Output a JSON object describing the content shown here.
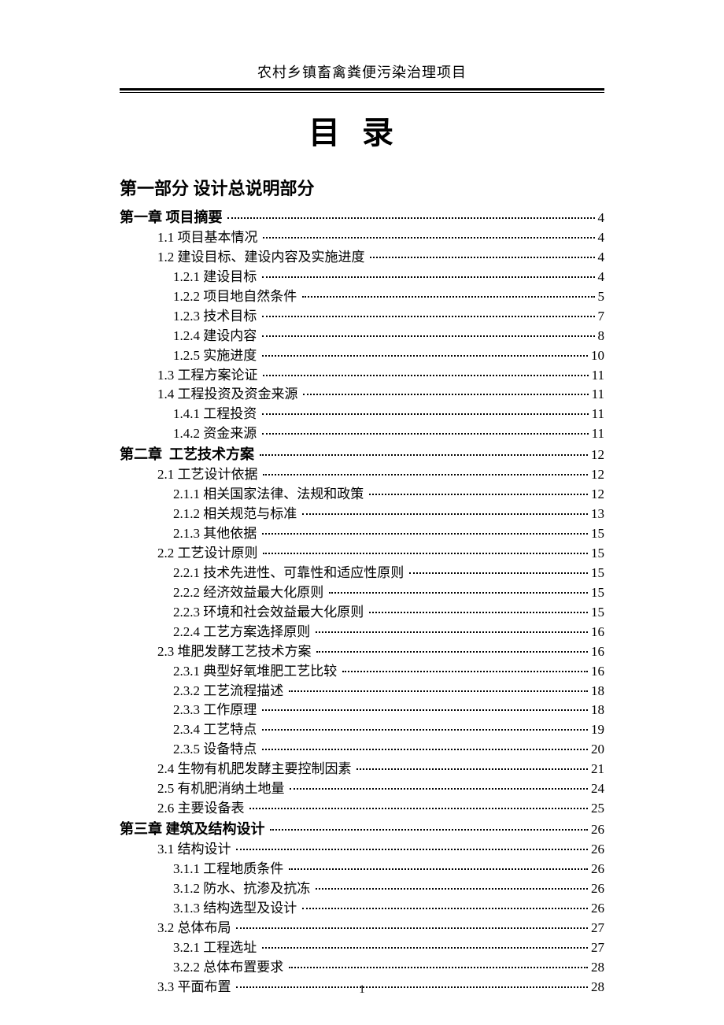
{
  "running_head": "农村乡镇畜禽粪便污染治理项目",
  "doc_title": "目录",
  "part_title": "第一部分 设计总说明部分",
  "toc_entries": [
    {
      "level": 0,
      "label": "第一章 项目摘要",
      "page": "4"
    },
    {
      "level": 1,
      "label": "1.1 项目基本情况",
      "page": "4"
    },
    {
      "level": 1,
      "label": "1.2 建设目标、建设内容及实施进度",
      "page": "4"
    },
    {
      "level": 2,
      "label": "1.2.1 建设目标",
      "page": "4"
    },
    {
      "level": 2,
      "label": "1.2.2 项目地自然条件",
      "page": "5"
    },
    {
      "level": 2,
      "label": "1.2.3 技术目标",
      "page": "7"
    },
    {
      "level": 2,
      "label": "1.2.4 建设内容",
      "page": "8"
    },
    {
      "level": 2,
      "label": "1.2.5 实施进度",
      "page": "10"
    },
    {
      "level": 1,
      "label": "1.3 工程方案论证",
      "page": "11"
    },
    {
      "level": 1,
      "label": "1.4 工程投资及资金来源",
      "page": "11"
    },
    {
      "level": 2,
      "label": "1.4.1 工程投资",
      "page": "11"
    },
    {
      "level": 2,
      "label": "1.4.2 资金来源",
      "page": "11"
    },
    {
      "level": 0,
      "label": "第二章  工艺技术方案",
      "page": "12"
    },
    {
      "level": 1,
      "label": "2.1 工艺设计依据",
      "page": "12"
    },
    {
      "level": 2,
      "label": "2.1.1 相关国家法律、法规和政策",
      "page": "12"
    },
    {
      "level": 2,
      "label": "2.1.2 相关规范与标准",
      "page": "13"
    },
    {
      "level": 2,
      "label": "2.1.3 其他依据",
      "page": "15"
    },
    {
      "level": 1,
      "label": "2.2 工艺设计原则",
      "page": "15"
    },
    {
      "level": 2,
      "label": "2.2.1 技术先进性、可靠性和适应性原则",
      "page": "15"
    },
    {
      "level": 2,
      "label": "2.2.2 经济效益最大化原则",
      "page": "15"
    },
    {
      "level": 2,
      "label": "2.2.3 环境和社会效益最大化原则",
      "page": "15"
    },
    {
      "level": 2,
      "label": "2.2.4 工艺方案选择原则",
      "page": "16"
    },
    {
      "level": 1,
      "label": "2.3 堆肥发酵工艺技术方案",
      "page": "16"
    },
    {
      "level": 2,
      "label": "2.3.1 典型好氧堆肥工艺比较",
      "page": "16"
    },
    {
      "level": 2,
      "label": "2.3.2 工艺流程描述",
      "page": "18"
    },
    {
      "level": 2,
      "label": "2.3.3 工作原理",
      "page": "18"
    },
    {
      "level": 2,
      "label": "2.3.4 工艺特点",
      "page": "19"
    },
    {
      "level": 2,
      "label": "2.3.5 设备特点",
      "page": "20"
    },
    {
      "level": 1,
      "label": "2.4 生物有机肥发酵主要控制因素",
      "page": "21"
    },
    {
      "level": 1,
      "label": "2.5 有机肥消纳土地量",
      "page": "24"
    },
    {
      "level": 1,
      "label": "2.6 主要设备表",
      "page": "25"
    },
    {
      "level": 0,
      "label": "第三章 建筑及结构设计",
      "page": "26"
    },
    {
      "level": 1,
      "label": "3.1 结构设计",
      "page": "26"
    },
    {
      "level": 2,
      "label": "3.1.1 工程地质条件",
      "page": "26"
    },
    {
      "level": 2,
      "label": "3.1.2 防水、抗渗及抗冻",
      "page": "26"
    },
    {
      "level": 2,
      "label": "3.1.3 结构选型及设计",
      "page": "26"
    },
    {
      "level": 1,
      "label": "3.2 总体布局",
      "page": "27"
    },
    {
      "level": 2,
      "label": "3.2.1 工程选址",
      "page": "27"
    },
    {
      "level": 2,
      "label": "3.2.2 总体布置要求",
      "page": "28"
    },
    {
      "level": 1,
      "label": "3.3 平面布置",
      "page": "28"
    }
  ],
  "page_number": "1"
}
